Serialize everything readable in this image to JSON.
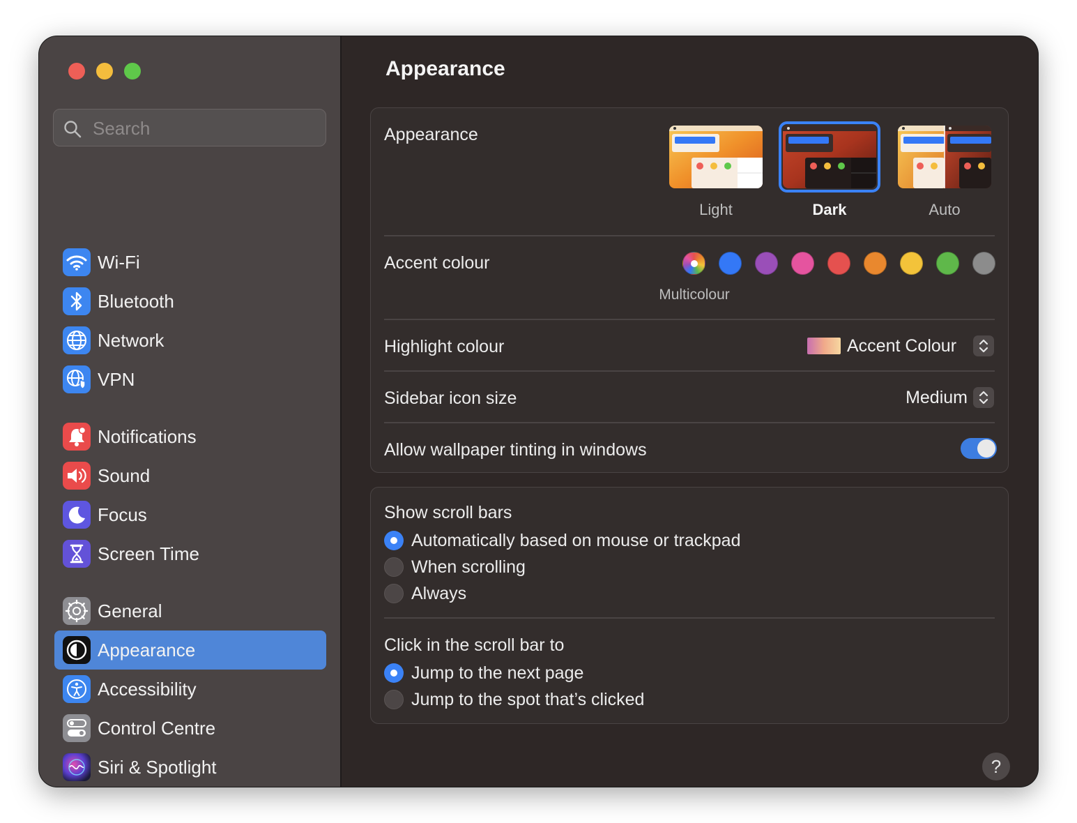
{
  "window": {
    "title": "Appearance"
  },
  "sidebar": {
    "search_placeholder": "Search",
    "items": [
      {
        "label": "Wi-Fi",
        "icon": "wifi-icon"
      },
      {
        "label": "Bluetooth",
        "icon": "bluetooth-icon"
      },
      {
        "label": "Network",
        "icon": "globe-icon"
      },
      {
        "label": "VPN",
        "icon": "vpn-globe-shield-icon"
      },
      {
        "label": "Notifications",
        "icon": "bell-icon"
      },
      {
        "label": "Sound",
        "icon": "speaker-icon"
      },
      {
        "label": "Focus",
        "icon": "moon-icon"
      },
      {
        "label": "Screen Time",
        "icon": "hourglass-icon"
      },
      {
        "label": "General",
        "icon": "gear-icon"
      },
      {
        "label": "Appearance",
        "icon": "appearance-icon",
        "selected": true
      },
      {
        "label": "Accessibility",
        "icon": "accessibility-icon"
      },
      {
        "label": "Control Centre",
        "icon": "toggles-icon"
      },
      {
        "label": "Siri & Spotlight",
        "icon": "siri-icon"
      }
    ]
  },
  "main": {
    "title": "Appearance",
    "appearance": {
      "label": "Appearance",
      "options": [
        {
          "label": "Light",
          "selected": false
        },
        {
          "label": "Dark",
          "selected": true
        },
        {
          "label": "Auto",
          "selected": false
        }
      ]
    },
    "accent": {
      "label": "Accent colour",
      "colors": [
        {
          "name": "multicolour",
          "hex": "#ffffff"
        },
        {
          "name": "blue",
          "hex": "#3478f6"
        },
        {
          "name": "purple",
          "hex": "#9a4fb8"
        },
        {
          "name": "pink",
          "hex": "#e5549f"
        },
        {
          "name": "red",
          "hex": "#e5514f"
        },
        {
          "name": "orange",
          "hex": "#e9882e"
        },
        {
          "name": "yellow",
          "hex": "#f3c33a"
        },
        {
          "name": "green",
          "hex": "#5fb84a"
        },
        {
          "name": "graphite",
          "hex": "#8c8c8c"
        }
      ],
      "selected_caption": "Multicolour"
    },
    "highlight": {
      "label": "Highlight colour",
      "value": "Accent Colour"
    },
    "sidebar_icon_size": {
      "label": "Sidebar icon size",
      "value": "Medium"
    },
    "wallpaper_tinting": {
      "label": "Allow wallpaper tinting in windows",
      "enabled": true
    },
    "scroll_bars": {
      "label": "Show scroll bars",
      "options": [
        {
          "label": "Automatically based on mouse or trackpad",
          "selected": true
        },
        {
          "label": "When scrolling",
          "selected": false
        },
        {
          "label": "Always",
          "selected": false
        }
      ]
    },
    "click_scroll": {
      "label": "Click in the scroll bar to",
      "options": [
        {
          "label": "Jump to the next page",
          "selected": true
        },
        {
          "label": "Jump to the spot that’s clicked",
          "selected": false
        }
      ]
    },
    "help_label": "?"
  },
  "colors": {
    "accent": "#3b82f6",
    "sidebar_selected": "#4f86d8",
    "window_bg": "#2e2726",
    "sidebar_bg": "#4a4444"
  }
}
